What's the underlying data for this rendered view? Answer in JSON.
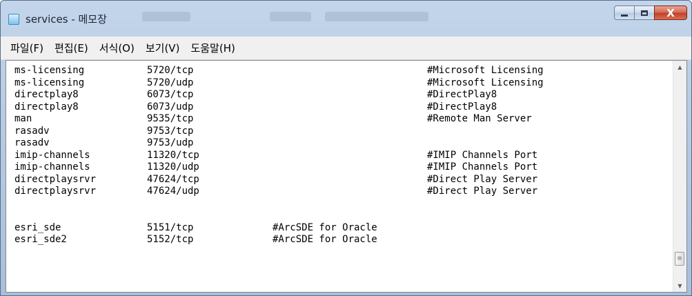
{
  "window": {
    "title": "services - 메모장",
    "controls": {
      "minimize": "",
      "maximize": "",
      "close": "X"
    }
  },
  "menu": [
    "파일(F)",
    "편집(E)",
    "서식(O)",
    "보기(V)",
    "도움말(H)"
  ],
  "colors": {
    "title_bar": "#b7cbe3",
    "close_button": "#c0402a",
    "editor_bg": "#ffffff"
  },
  "icons": {
    "app": "notepad-icon",
    "scroll_up": "arrow-up-icon",
    "scroll_down": "arrow-down-icon",
    "scroll_thumb": "grip-icon"
  },
  "lines": [
    {
      "name": "ms-licensing",
      "port": "5720/tcp",
      "comment_mid": "",
      "comment": "#Microsoft Licensing"
    },
    {
      "name": "ms-licensing",
      "port": "5720/udp",
      "comment_mid": "",
      "comment": "#Microsoft Licensing"
    },
    {
      "name": "directplay8",
      "port": "6073/tcp",
      "comment_mid": "",
      "comment": "#DirectPlay8"
    },
    {
      "name": "directplay8",
      "port": "6073/udp",
      "comment_mid": "",
      "comment": "#DirectPlay8"
    },
    {
      "name": "man",
      "port": "9535/tcp",
      "comment_mid": "",
      "comment": "#Remote Man Server"
    },
    {
      "name": "rasadv",
      "port": "9753/tcp",
      "comment_mid": "",
      "comment": ""
    },
    {
      "name": "rasadv",
      "port": "9753/udp",
      "comment_mid": "",
      "comment": ""
    },
    {
      "name": "imip-channels",
      "port": "11320/tcp",
      "comment_mid": "",
      "comment": "#IMIP Channels Port"
    },
    {
      "name": "imip-channels",
      "port": "11320/udp",
      "comment_mid": "",
      "comment": "#IMIP Channels Port"
    },
    {
      "name": "directplaysrvr",
      "port": "47624/tcp",
      "comment_mid": "",
      "comment": "#Direct Play Server"
    },
    {
      "name": "directplaysrvr",
      "port": "47624/udp",
      "comment_mid": "",
      "comment": "#Direct Play Server"
    },
    {
      "name": "",
      "port": "",
      "comment_mid": "",
      "comment": ""
    },
    {
      "name": "",
      "port": "",
      "comment_mid": "",
      "comment": ""
    },
    {
      "name": "esri_sde",
      "port": "5151/tcp",
      "comment_mid": "#ArcSDE for Oracle",
      "comment": ""
    },
    {
      "name": "esri_sde2",
      "port": "5152/tcp",
      "comment_mid": "#ArcSDE for Oracle",
      "comment": ""
    }
  ]
}
